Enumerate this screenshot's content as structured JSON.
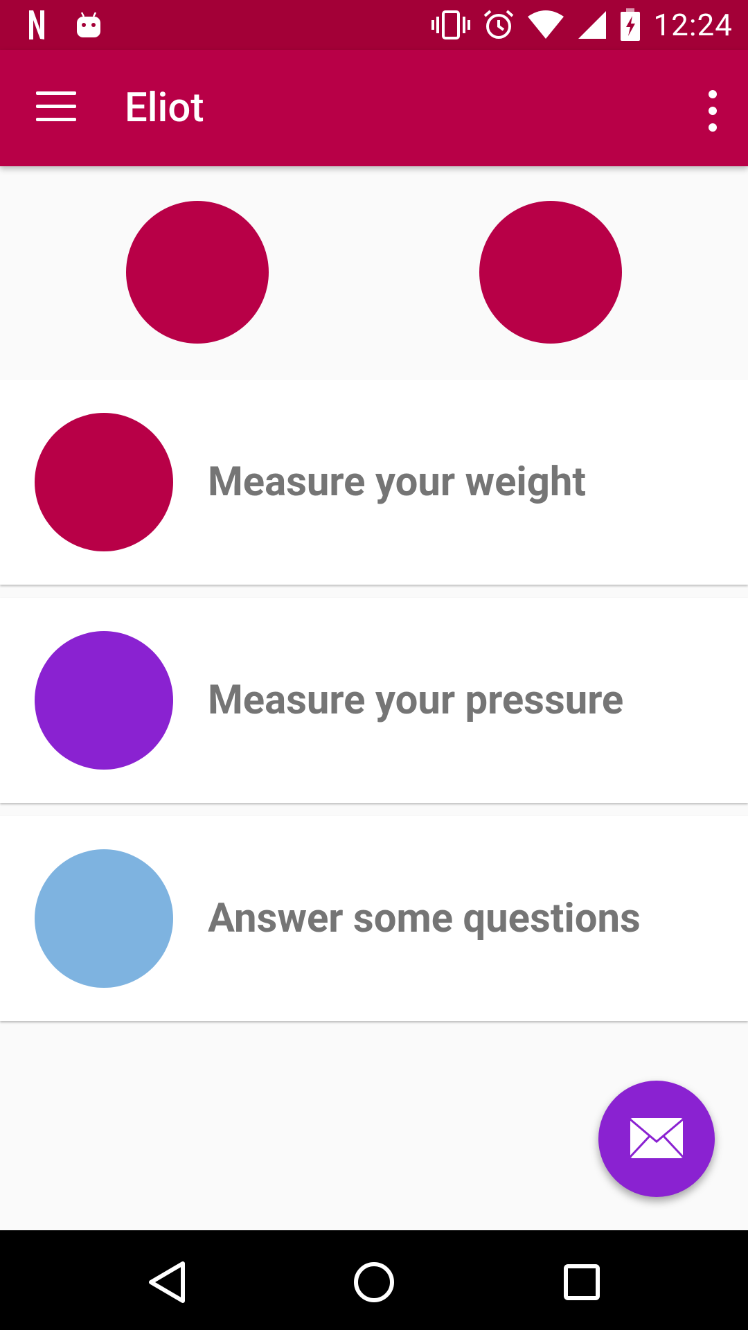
{
  "status_bar": {
    "time": "12:24",
    "icons": [
      "netflix-icon",
      "android-icon",
      "vibrate-icon",
      "alarm-icon",
      "wifi-icon",
      "signal-icon",
      "battery-charging-icon"
    ]
  },
  "app_bar": {
    "title": "Eliot",
    "menu_icon": "menu-icon",
    "overflow_icon": "more-vert-icon"
  },
  "header": {
    "circles": [
      {
        "color": "#b80047"
      },
      {
        "color": "#b80047"
      }
    ]
  },
  "cards": [
    {
      "label": "Measure your weight",
      "color": "#b80047"
    },
    {
      "label": "Measure your pressure",
      "color": "#8a22d1"
    },
    {
      "label": "Answer some questions",
      "color": "#7eb3e0"
    }
  ],
  "fab": {
    "icon": "email-icon",
    "color": "#8a22d1"
  },
  "nav_bar": {
    "buttons": [
      "back-icon",
      "home-icon",
      "recents-icon"
    ]
  },
  "colors": {
    "status_bar": "#a30037",
    "app_bar": "#b80047",
    "text_gray": "#757575",
    "background": "#fafafa"
  }
}
